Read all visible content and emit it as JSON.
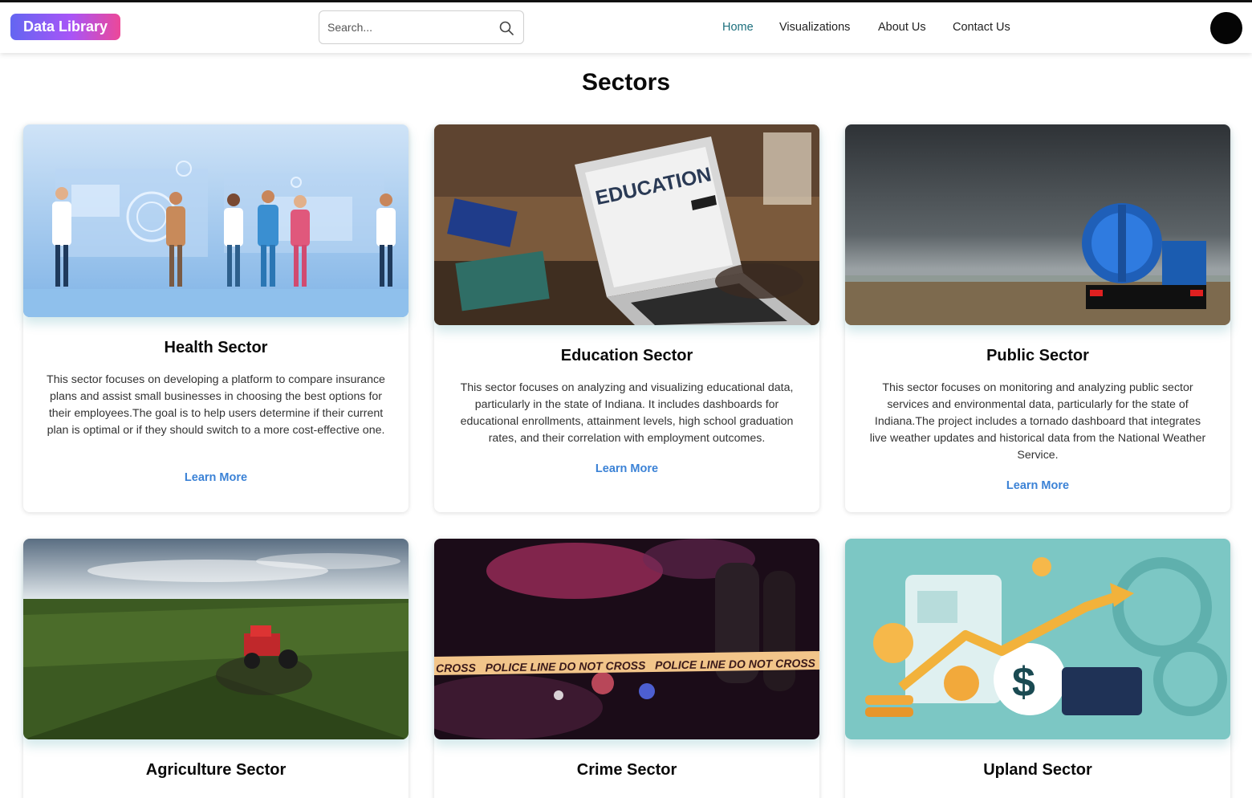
{
  "header": {
    "logo": "Data Library",
    "search": {
      "placeholder": "Search...",
      "value": ""
    },
    "nav": [
      "Home",
      "Visualizations",
      "About Us",
      "Contact Us"
    ],
    "active_nav": "Home"
  },
  "page": {
    "title": "Sectors"
  },
  "cards": [
    {
      "title": "Health Sector",
      "description": "This sector focuses on developing a platform to compare insurance plans and assist small businesses in choosing the best options for their employees.The goal is to help users determine if their current plan is optimal or if they should switch to a more cost-effective one.",
      "link": "Learn More"
    },
    {
      "title": "Education Sector",
      "description": "This sector focuses on analyzing and visualizing educational data, particularly in the state of Indiana. It includes dashboards for educational enrollments, attainment levels, high school graduation rates, and their correlation with employment outcomes.",
      "link": "Learn More",
      "image_text": "EDUCATION"
    },
    {
      "title": "Public Sector",
      "description": "This sector focuses on monitoring and analyzing public sector services and environmental data, particularly for the state of Indiana.The project includes a tornado dashboard that integrates live weather updates and historical data from the National Weather Service.",
      "link": "Learn More"
    },
    {
      "title": "Agriculture Sector"
    },
    {
      "title": "Crime Sector",
      "image_text": "CROSS   POLICE LINE DO NOT CROSS   POLICE LINE DO NOT CROSS   POLICE"
    },
    {
      "title": "Upland Sector"
    }
  ],
  "colors": {
    "logo_gradient": [
      "#6366f1",
      "#a855f7",
      "#ec4899"
    ],
    "nav_active": "#1c6f7d",
    "link": "#3b82d6"
  },
  "icons": {
    "search": "search-icon",
    "avatar": "avatar"
  }
}
